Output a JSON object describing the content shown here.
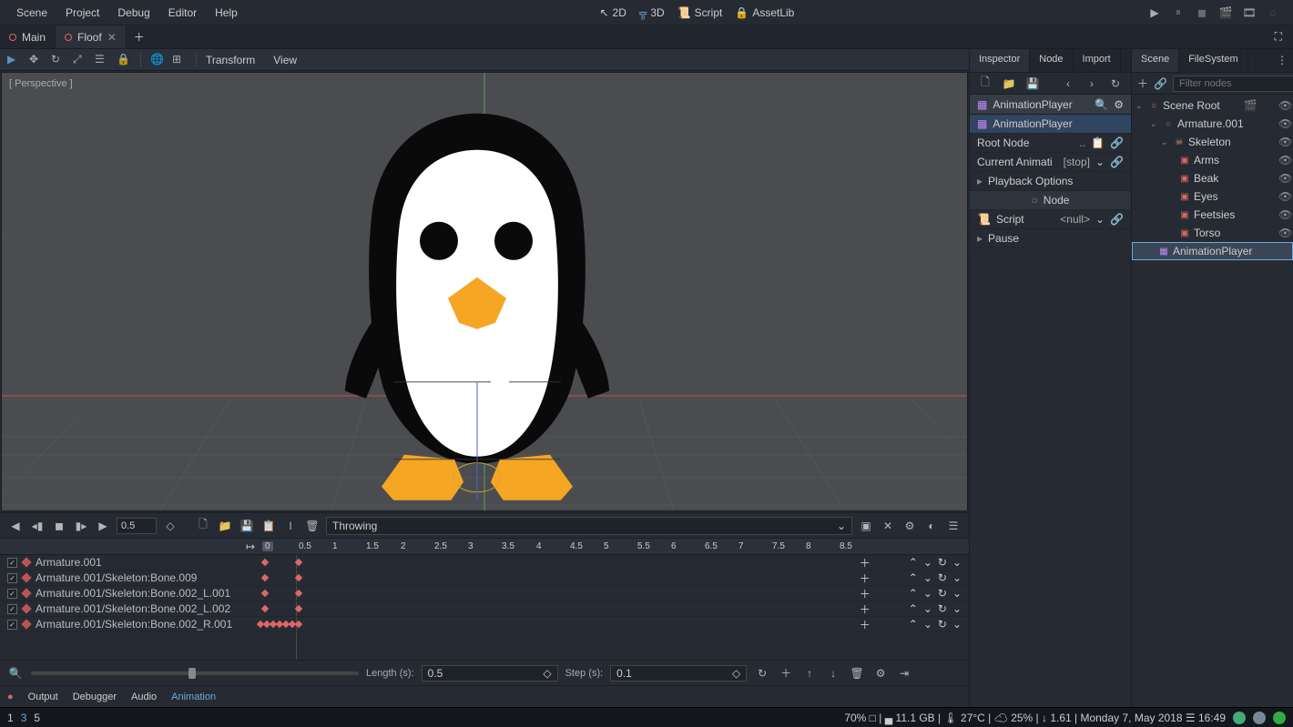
{
  "menubar": {
    "items": [
      "Scene",
      "Project",
      "Debug",
      "Editor",
      "Help"
    ]
  },
  "workspace": {
    "mode_2d": "2D",
    "mode_3d": "3D",
    "script": "Script",
    "assetlib": "AssetLib"
  },
  "scene_tabs": [
    {
      "label": "Main",
      "active": false,
      "dirty": false
    },
    {
      "label": "Floof",
      "active": true,
      "dirty": false
    }
  ],
  "viewport": {
    "toolbar": [
      "Transform",
      "View"
    ],
    "perspective": "[ Perspective ]"
  },
  "animation": {
    "time_value": "0.5",
    "name": "Throwing",
    "ruler": [
      "0",
      "0.5",
      "1",
      "1.5",
      "2",
      "2.5",
      "3",
      "3.5",
      "4",
      "4.5",
      "5",
      "5.5",
      "6",
      "6.5",
      "7",
      "7.5",
      "8",
      "8.5"
    ],
    "tracks": [
      "Armature.001",
      "Armature.001/Skeleton:Bone.009",
      "Armature.001/Skeleton:Bone.002_L.001",
      "Armature.001/Skeleton:Bone.002_L.002",
      "Armature.001/Skeleton:Bone.002_R.001"
    ],
    "length_label": "Length (s):",
    "length_value": "0.5",
    "step_label": "Step (s):",
    "step_value": "0.1"
  },
  "bottom_tabs": [
    "Output",
    "Debugger",
    "Audio",
    "Animation"
  ],
  "inspector": {
    "tabs": [
      "Inspector",
      "Node",
      "Import"
    ],
    "object": "AnimationPlayer",
    "selected_type": "AnimationPlayer",
    "rows": [
      {
        "label": "Root Node",
        "value": "..",
        "extra": true
      },
      {
        "label": "Current Animati",
        "value": "[stop]",
        "dropdown": true
      },
      {
        "label": "Playback Options",
        "value": "",
        "expandable": true
      },
      {
        "label": "Node",
        "value": "",
        "header": true
      },
      {
        "label": "Script",
        "value": "<null>",
        "dropdown": true
      },
      {
        "label": "Pause",
        "value": "",
        "expandable": true
      }
    ]
  },
  "scene_dock": {
    "tabs": [
      "Scene",
      "FileSystem"
    ],
    "filter_placeholder": "Filter nodes",
    "tree": [
      {
        "name": "Scene Root",
        "depth": 0,
        "icon": "node3d",
        "expanded": true
      },
      {
        "name": "Armature.001",
        "depth": 1,
        "icon": "node3d",
        "expanded": true
      },
      {
        "name": "Skeleton",
        "depth": 2,
        "icon": "skeleton",
        "expanded": true
      },
      {
        "name": "Arms",
        "depth": 3,
        "icon": "mesh"
      },
      {
        "name": "Beak",
        "depth": 3,
        "icon": "mesh"
      },
      {
        "name": "Eyes",
        "depth": 3,
        "icon": "mesh"
      },
      {
        "name": "Feetsies",
        "depth": 3,
        "icon": "mesh"
      },
      {
        "name": "Torso",
        "depth": 3,
        "icon": "mesh"
      },
      {
        "name": "AnimationPlayer",
        "depth": 1,
        "icon": "anim",
        "selected": true
      }
    ]
  },
  "statusbar": {
    "left": [
      "1",
      "3",
      "5"
    ],
    "right": "70% □ | ▄ 11.1 GB | 🌡 27°C | ☁ 25% | ↓ 1.61 | Monday  7, May 2018  ☰ 16:49"
  }
}
